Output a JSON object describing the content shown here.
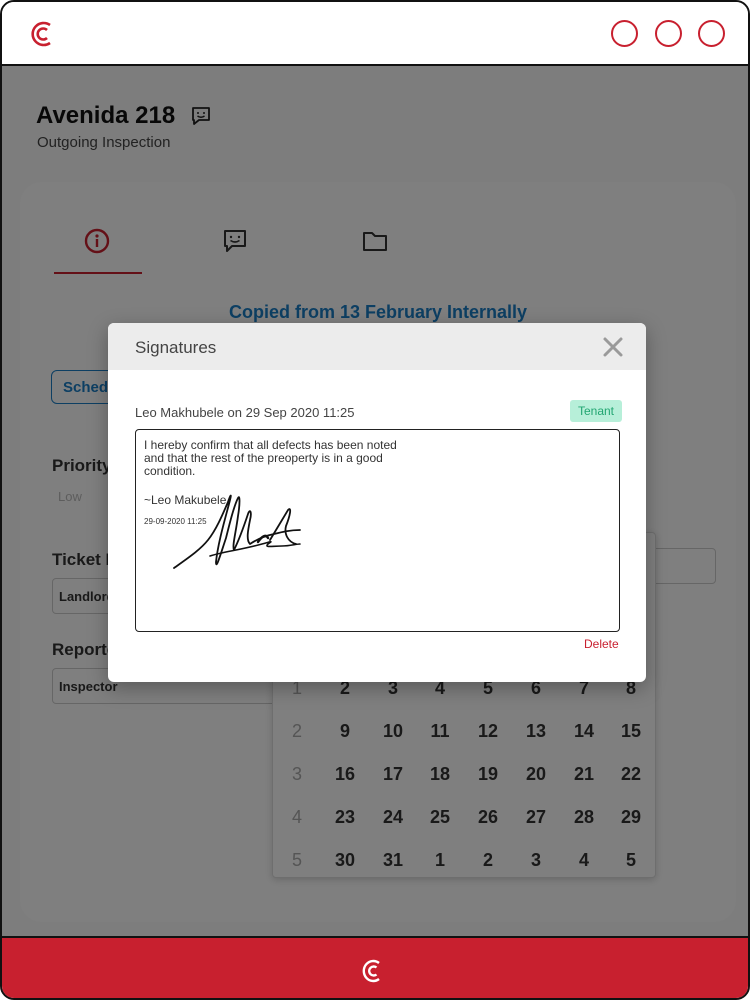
{
  "colors": {
    "brand": "#c8202f",
    "link": "#1a7ec7",
    "badge_bg": "#b7efd9",
    "badge_text": "#22a672"
  },
  "header": {
    "logo_icon": "brand-c-logo",
    "window_controls": [
      "circle-button",
      "circle-button",
      "circle-button"
    ]
  },
  "page": {
    "title": "Avenida 218",
    "subtitle": "Outgoing Inspection",
    "tabs": [
      {
        "icon": "info-icon",
        "active": true
      },
      {
        "icon": "chat-smile-icon",
        "active": false
      },
      {
        "icon": "folder-icon",
        "active": false
      }
    ],
    "copied_notice": "Copied from 13 February Internally",
    "schedule_button": "Schedu",
    "priority": {
      "label": "Priority",
      "option_low": "Low"
    },
    "ticket": {
      "label": "Ticket F",
      "value": "Landlord"
    },
    "reporter": {
      "label": "Reporte",
      "value": "Inspector"
    }
  },
  "calendar": {
    "rows": [
      {
        "week": "1",
        "days": [
          "2",
          "3",
          "4",
          "5",
          "6",
          "7",
          "8"
        ]
      },
      {
        "week": "2",
        "days": [
          "9",
          "10",
          "11",
          "12",
          "13",
          "14",
          "15"
        ]
      },
      {
        "week": "3",
        "days": [
          "16",
          "17",
          "18",
          "19",
          "20",
          "21",
          "22"
        ]
      },
      {
        "week": "4",
        "days": [
          "23",
          "24",
          "25",
          "26",
          "27",
          "28",
          "29"
        ]
      },
      {
        "week": "5",
        "days": [
          "30",
          "31",
          "1",
          "2",
          "3",
          "4",
          "5"
        ]
      }
    ]
  },
  "modal": {
    "title": "Signatures",
    "signer_meta": "Leo Makhubele on 29 Sep 2020 11:25",
    "role_badge": "Tenant",
    "statement": "I hereby confirm that all defects has been noted and that the rest of the preoperty is in a good condition.",
    "signer_name": "~Leo Makubele",
    "signed_at": "29-09-2020 11:25",
    "delete_label": "Delete"
  },
  "footer": {
    "logo_icon": "brand-c-logo"
  }
}
